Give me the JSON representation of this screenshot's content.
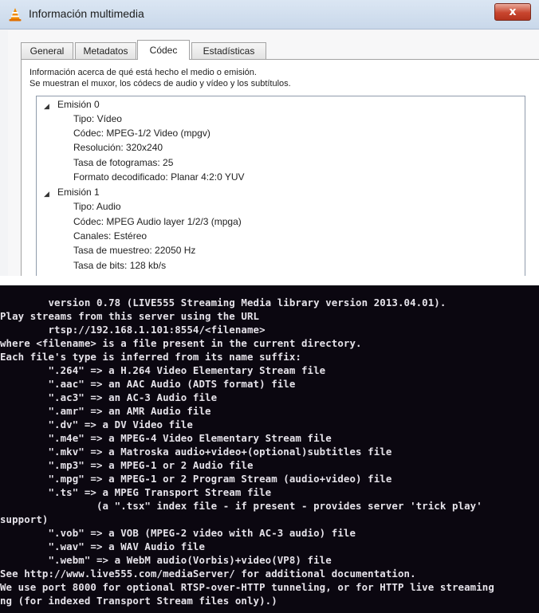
{
  "window": {
    "title": "Información multimedia",
    "close_glyph": "x",
    "tabs": [
      {
        "label": "General"
      },
      {
        "label": "Metadatos"
      },
      {
        "label": "Códec"
      },
      {
        "label": "Estadísticas"
      }
    ],
    "active_tab": "Códec",
    "description_line1": "Información acerca de qué está hecho el medio o emisión.",
    "description_line2": "Se muestran el muxor, los códecs de audio y vídeo y los subtítulos.",
    "tree": [
      {
        "label": "Emisión 0",
        "expanded": true
      },
      {
        "label": "Tipo: Vídeo"
      },
      {
        "label": "Códec: MPEG-1/2 Video (mpgv)"
      },
      {
        "label": "Resolución: 320x240"
      },
      {
        "label": "Tasa de fotogramas: 25"
      },
      {
        "label": "Formato decodificado: Planar 4:2:0 YUV"
      },
      {
        "label": "Emisión 1",
        "expanded": true
      },
      {
        "label": "Tipo: Audio"
      },
      {
        "label": "Códec: MPEG Audio layer 1/2/3 (mpga)"
      },
      {
        "label": "Canales: Estéreo"
      },
      {
        "label": "Tasa de muestreo: 22050 Hz"
      },
      {
        "label": "Tasa de bits: 128 kb/s"
      }
    ]
  },
  "terminal": {
    "lines": [
      "        version 0.78 (LIVE555 Streaming Media library version 2013.04.01).",
      "Play streams from this server using the URL",
      "        rtsp://192.168.1.101:8554/<filename>",
      "where <filename> is a file present in the current directory.",
      "Each file's type is inferred from its name suffix:",
      "        \".264\" => a H.264 Video Elementary Stream file",
      "        \".aac\" => an AAC Audio (ADTS format) file",
      "        \".ac3\" => an AC-3 Audio file",
      "        \".amr\" => an AMR Audio file",
      "        \".dv\" => a DV Video file",
      "        \".m4e\" => a MPEG-4 Video Elementary Stream file",
      "        \".mkv\" => a Matroska audio+video+(optional)subtitles file",
      "        \".mp3\" => a MPEG-1 or 2 Audio file",
      "        \".mpg\" => a MPEG-1 or 2 Program Stream (audio+video) file",
      "        \".ts\" => a MPEG Transport Stream file",
      "                (a \".tsx\" index file - if present - provides server 'trick play'",
      "support)",
      "        \".vob\" => a VOB (MPEG-2 video with AC-3 audio) file",
      "        \".wav\" => a WAV Audio file",
      "        \".webm\" => a WebM audio(Vorbis)+video(VP8) file",
      "See http://www.live555.com/mediaServer/ for additional documentation.",
      "We use port 8000 for optional RTSP-over-HTTP tunneling, or for HTTP live streaming",
      "ng (for indexed Transport Stream files only).)"
    ]
  },
  "colors": {
    "terminal_bg": "#0b0710",
    "terminal_fg": "#e6e3ea",
    "titlebar": "#d2dfef",
    "close_button": "#c8452e"
  }
}
